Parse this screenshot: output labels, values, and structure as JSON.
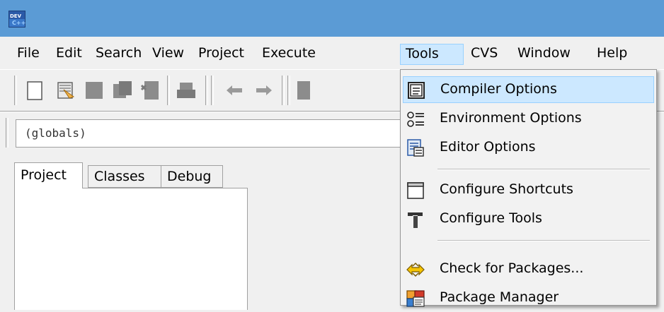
{
  "menubar": {
    "items": [
      "File",
      "Edit",
      "Search",
      "View",
      "Project",
      "Execute",
      "Tools",
      "CVS",
      "Window",
      "Help"
    ],
    "active": "Tools"
  },
  "class_combo": {
    "value": "(globals)"
  },
  "left_panel": {
    "tabs": [
      "Project",
      "Classes",
      "Debug"
    ],
    "selected_tab": "Project"
  },
  "tools_menu": {
    "items": [
      {
        "label": "Compiler Options",
        "icon": "compiler-options-icon",
        "highlighted": true
      },
      {
        "label": "Environment Options",
        "icon": "environment-options-icon"
      },
      {
        "label": "Editor Options",
        "icon": "editor-options-icon"
      },
      {
        "label": "Configure Shortcuts",
        "icon": "configure-shortcuts-icon"
      },
      {
        "label": "Configure Tools",
        "icon": "hammer-icon"
      },
      {
        "label": "Check for Packages...",
        "icon": "check-packages-icon"
      },
      {
        "label": "Package Manager",
        "icon": "package-manager-icon"
      }
    ]
  },
  "colors": {
    "titlebar": "#5b9bd5",
    "menu_highlight": "#cce8ff",
    "menu_highlight_border": "#99d1ff"
  }
}
